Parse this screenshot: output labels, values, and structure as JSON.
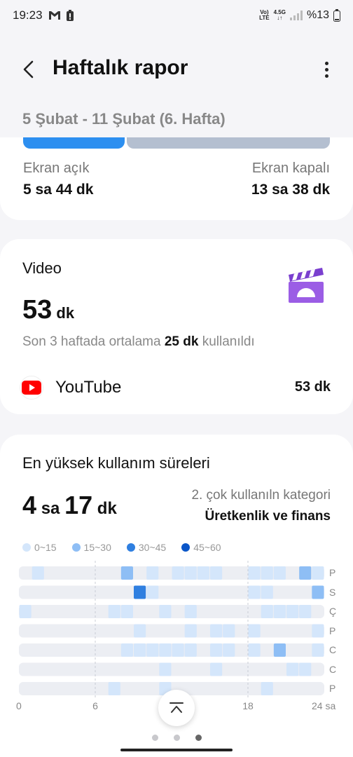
{
  "status_bar": {
    "time": "19:23",
    "network_top": "Vo)",
    "network_bottom": "LTE",
    "signal_top": "4.5G",
    "battery": "%13"
  },
  "header": {
    "title": "Haftalık rapor"
  },
  "week": {
    "label": "5 Şubat - 11 Şubat (6. Hafta)"
  },
  "screen_time": {
    "on_label": "Ekran açık",
    "on_value": "5 sa 44 dk",
    "off_label": "Ekran kapalı",
    "off_value": "13 sa 38 dk",
    "on_share": 0.3
  },
  "video": {
    "title": "Video",
    "time_number": "53",
    "time_unit": "dk",
    "avg_prefix": "Son 3 haftada ortalama",
    "avg_value": "25 dk",
    "avg_suffix": "kullanıldı",
    "apps": [
      {
        "name": "YouTube",
        "time": "53 dk",
        "icon": "youtube-icon"
      }
    ]
  },
  "peak": {
    "title": "En yüksek kullanım süreleri",
    "value_hours": "4",
    "value_hours_unit": "sa",
    "value_minutes": "17",
    "value_minutes_unit": "dk",
    "category_label": "2. çok kullanıln kategori",
    "category_value": "Üretkenlik ve finans"
  },
  "chart_data": {
    "type": "heatmap",
    "legend": [
      {
        "label": "0~15",
        "color": "#d4e6fb"
      },
      {
        "label": "15~30",
        "color": "#8ebef5"
      },
      {
        "label": "30~45",
        "color": "#2f7fe0"
      },
      {
        "label": "45~60",
        "color": "#0a56c8"
      }
    ],
    "rows": [
      "P",
      "S",
      "Ç",
      "P",
      "C",
      "C",
      "P"
    ],
    "x_ticks": [
      "0",
      "6",
      "18",
      "24 sa"
    ],
    "x_tick_values": [
      0,
      6,
      18,
      24
    ],
    "hours": 24,
    "levels": [
      [
        0,
        1,
        0,
        0,
        0,
        0,
        0,
        0,
        2,
        0,
        1,
        0,
        1,
        1,
        1,
        1,
        0,
        0,
        1,
        1,
        1,
        0,
        2,
        1
      ],
      [
        0,
        0,
        0,
        0,
        0,
        0,
        0,
        0,
        0,
        3,
        1,
        0,
        0,
        0,
        0,
        0,
        0,
        0,
        1,
        1,
        0,
        0,
        0,
        2
      ],
      [
        1,
        0,
        0,
        0,
        0,
        0,
        0,
        1,
        1,
        0,
        0,
        1,
        0,
        1,
        0,
        0,
        0,
        0,
        0,
        1,
        1,
        1,
        1,
        0
      ],
      [
        0,
        0,
        0,
        0,
        0,
        0,
        0,
        0,
        0,
        1,
        0,
        0,
        0,
        1,
        0,
        1,
        1,
        0,
        1,
        0,
        0,
        0,
        0,
        1
      ],
      [
        0,
        0,
        0,
        0,
        0,
        0,
        0,
        0,
        1,
        1,
        1,
        1,
        1,
        1,
        0,
        1,
        1,
        0,
        1,
        0,
        2,
        0,
        0,
        1
      ],
      [
        0,
        0,
        0,
        0,
        0,
        0,
        0,
        0,
        0,
        0,
        0,
        1,
        0,
        0,
        0,
        1,
        0,
        0,
        0,
        0,
        0,
        1,
        1,
        0
      ],
      [
        0,
        0,
        0,
        0,
        0,
        0,
        0,
        1,
        0,
        0,
        0,
        1,
        0,
        0,
        0,
        0,
        0,
        0,
        0,
        1,
        0,
        0,
        0,
        0
      ]
    ]
  }
}
